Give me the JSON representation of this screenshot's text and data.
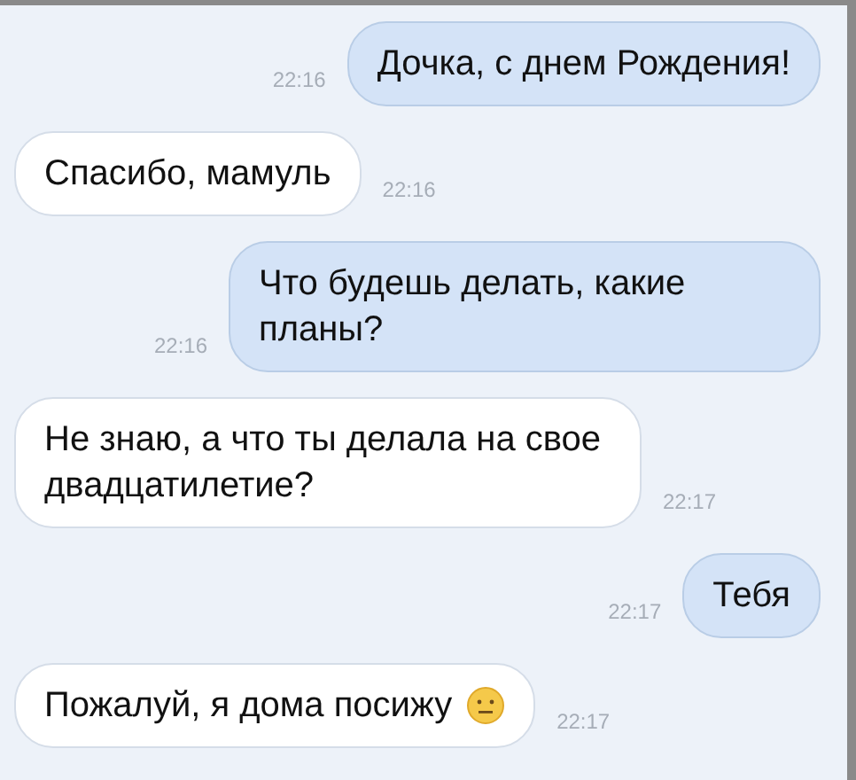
{
  "messages": [
    {
      "kind": "sent",
      "text": "Дочка, с днем Рождения!",
      "time": "22:16",
      "emoji": false
    },
    {
      "kind": "received",
      "text": "Спасибо, мамуль",
      "time": "22:16",
      "emoji": false
    },
    {
      "kind": "sent",
      "text": "Что будешь делать, какие планы?",
      "time": "22:16",
      "emoji": false
    },
    {
      "kind": "received",
      "text": "Не знаю, а что ты делала на свое двадцатилетие?",
      "time": "22:17",
      "emoji": false
    },
    {
      "kind": "sent",
      "text": "Тебя",
      "time": "22:17",
      "emoji": false
    },
    {
      "kind": "received",
      "text": "Пожалуй, я дома посижу",
      "time": "22:17",
      "emoji": true
    }
  ]
}
